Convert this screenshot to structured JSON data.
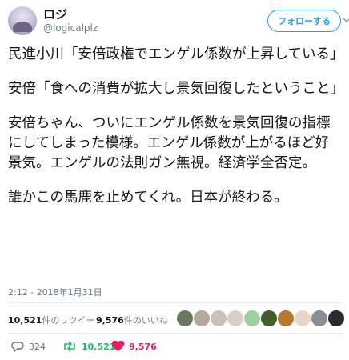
{
  "user": {
    "display_name": "ロジ",
    "handle": "@logicalplz"
  },
  "follow_button": "フォローする",
  "tweet": {
    "paragraphs": [
      "民進小川「安倍政権でエンゲル係数が上昇している」",
      "安倍「食への消費が拡大し景気回復したということ」",
      "安倍ちゃん、ついにエンゲル係数を景気回復の指標にしてしまった模様。エンゲル係数が上がるほど好景気。エンゲルの法則ガン無視。経済学全否定。",
      "誰かこの馬鹿を止めてくれ。日本が終わる。"
    ]
  },
  "timestamp": "2:12 - 2018年1月31日",
  "stats": {
    "retweets_num": "10,521",
    "retweets_label": "件のリツイート",
    "likes_num": "9,576",
    "likes_label": "件のいいね"
  },
  "actions": {
    "reply_count": "324",
    "retweet_count": "10,521",
    "like_count": "9,576"
  },
  "colors": {
    "accent": "#1da1f2",
    "retweet": "#17bf63",
    "like": "#e0245e",
    "muted": "#657786"
  },
  "liker_avatars": [
    "avatar-1",
    "avatar-2",
    "avatar-3",
    "avatar-4",
    "avatar-5",
    "avatar-6",
    "avatar-7",
    "avatar-8",
    "avatar-9",
    "avatar-10"
  ]
}
